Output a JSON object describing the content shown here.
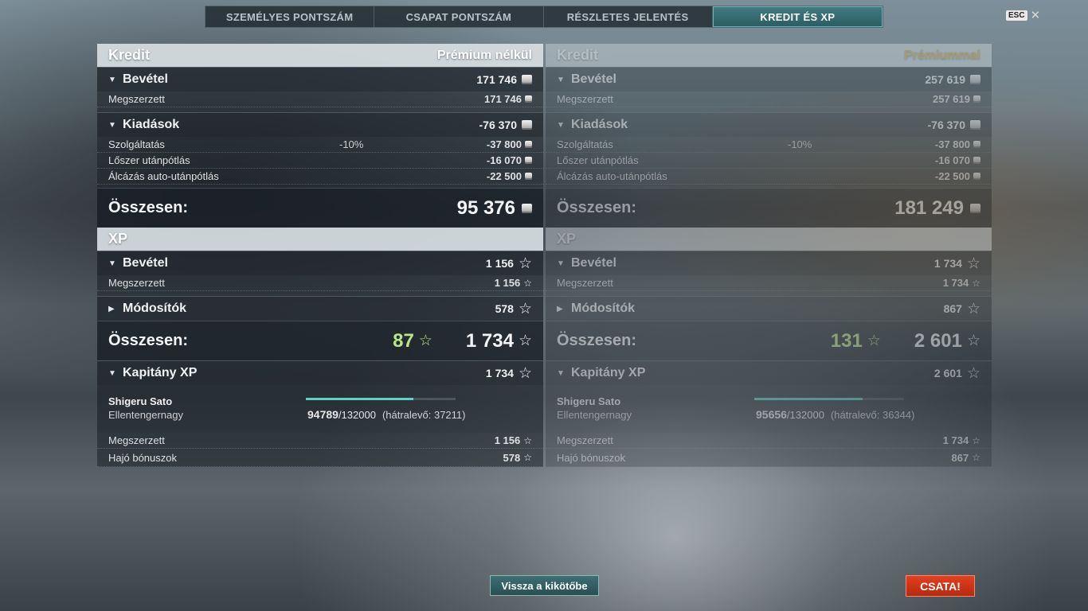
{
  "tabs": [
    "SZEMÉLYES PONTSZÁM",
    "CSAPAT PONTSZÁM",
    "RÉSZLETES JELENTÉS",
    "KREDIT ÉS XP"
  ],
  "active_tab_index": 3,
  "esc_label": "ESC",
  "colors": {
    "accent": "#3e7a7f",
    "premium_gold": "#e0b24a",
    "bonus_green": "#b9e58a",
    "battle_red": "#d0361a",
    "progress_teal": "#5fd0c8"
  },
  "left": {
    "credit_title": "Kredit",
    "credit_mode": "Prémium nélkül",
    "income_label": "Bevétel",
    "income_value": "171 746",
    "earned_label": "Megszerzett",
    "earned_value": "171 746",
    "expenses_label": "Kiadások",
    "expenses_value": "-76 370",
    "service_label": "Szolgáltatás",
    "service_pct": "-10%",
    "service_value": "-37 800",
    "ammo_label": "Lőszer utánpótlás",
    "ammo_value": "-16 070",
    "camo_label": "Álcázás auto-utánpótlás",
    "camo_value": "-22 500",
    "credit_total_label": "Összesen:",
    "credit_total_value": "95 376",
    "xp_title": "XP",
    "xp_income_label": "Bevétel",
    "xp_income_value": "1 156",
    "xp_earned_label": "Megszerzett",
    "xp_earned_value": "1 156",
    "modifiers_label": "Módosítók",
    "modifiers_value": "578",
    "xp_total_label": "Összesen:",
    "xp_bonus": "87",
    "xp_total_value": "1 734",
    "captain_label": "Kapitány XP",
    "captain_value": "1 734",
    "captain_name": "Shigeru Sato",
    "captain_rank": "Ellentengernagy",
    "captain_xp_current": "94789",
    "captain_xp_max": "/132000",
    "captain_remaining": "(hátralevő: 37211)",
    "captain_progress": 0.718,
    "cap_earned_label": "Megszerzett",
    "cap_earned_value": "1 156",
    "ship_bonus_label": "Hajó bónuszok",
    "ship_bonus_value": "578"
  },
  "right": {
    "credit_title": "Kredit",
    "credit_mode": "Prémiummal",
    "income_label": "Bevétel",
    "income_value": "257 619",
    "earned_label": "Megszerzett",
    "earned_value": "257 619",
    "expenses_label": "Kiadások",
    "expenses_value": "-76 370",
    "service_label": "Szolgáltatás",
    "service_pct": "-10%",
    "service_value": "-37 800",
    "ammo_label": "Lőszer utánpótlás",
    "ammo_value": "-16 070",
    "camo_label": "Álcázás auto-utánpótlás",
    "camo_value": "-22 500",
    "credit_total_label": "Összesen:",
    "credit_total_value": "181 249",
    "xp_title": "XP",
    "xp_income_label": "Bevétel",
    "xp_income_value": "1 734",
    "xp_earned_label": "Megszerzett",
    "xp_earned_value": "1 734",
    "modifiers_label": "Módosítók",
    "modifiers_value": "867",
    "xp_total_label": "Összesen:",
    "xp_bonus": "131",
    "xp_total_value": "2 601",
    "captain_label": "Kapitány XP",
    "captain_value": "2 601",
    "captain_name": "Shigeru Sato",
    "captain_rank": "Ellentengernagy",
    "captain_xp_current": "95656",
    "captain_xp_max": "/132000",
    "captain_remaining": "(hátralevő: 36344)",
    "captain_progress": 0.725,
    "cap_earned_label": "Megszerzett",
    "cap_earned_value": "1 734",
    "ship_bonus_label": "Hajó bónuszok",
    "ship_bonus_value": "867"
  },
  "buttons": {
    "back": "Vissza a kikötőbe",
    "battle": "CSATA!"
  }
}
